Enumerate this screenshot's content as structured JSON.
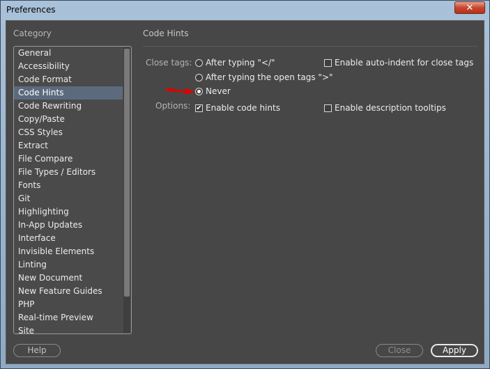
{
  "window": {
    "title": "Preferences",
    "close_glyph": "✕"
  },
  "category": {
    "title": "Category",
    "selected_index": 3,
    "items": [
      "General",
      "Accessibility",
      "Code Format",
      "Code Hints",
      "Code Rewriting",
      "Copy/Paste",
      "CSS Styles",
      "Extract",
      "File Compare",
      "File Types / Editors",
      "Fonts",
      "Git",
      "Highlighting",
      "In-App Updates",
      "Interface",
      "Invisible Elements",
      "Linting",
      "New Document",
      "New Feature Guides",
      "PHP",
      "Real-time Preview",
      "Site"
    ]
  },
  "panel": {
    "title": "Code Hints",
    "close_tags_label": "Close tags:",
    "options_label": "Options:",
    "radios": [
      {
        "label": "After typing \"</\"",
        "checked": false
      },
      {
        "label": "After typing the open tags \">\"",
        "checked": false
      },
      {
        "label": "Never",
        "checked": true
      }
    ],
    "checkboxes": [
      {
        "label": "Enable auto-indent for close tags",
        "checked": false
      },
      {
        "label": "Enable code hints",
        "checked": true
      },
      {
        "label": "Enable description tooltips",
        "checked": false
      }
    ]
  },
  "buttons": {
    "help": "Help",
    "close": "Close",
    "apply": "Apply"
  },
  "colors": {
    "accent_selection": "#5c6a7e",
    "annotation_arrow": "#e00000"
  }
}
